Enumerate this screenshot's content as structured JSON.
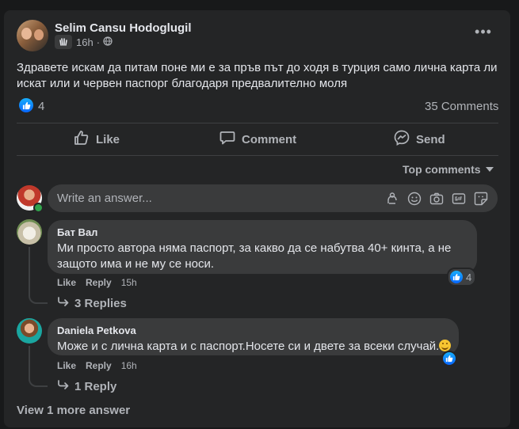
{
  "post": {
    "author": "Selim Cansu Hodoglugil",
    "time": "16h",
    "text": "Здравете искам да питам поне ми е за пръв път до ходя в турция само лична карта ли искат или и червен паспорг благодаря предвалително моля",
    "reaction_count": "4",
    "comments_count": "35 Comments"
  },
  "actions": {
    "like": "Like",
    "comment": "Comment",
    "send": "Send"
  },
  "sort_label": "Top comments",
  "composer": {
    "placeholder": "Write an answer..."
  },
  "comments": [
    {
      "author": "Бат Вал",
      "text": "Ми просто автора няма паспорт, за какво да се набутва 40+ кинта, а не защото има и не му се носи.",
      "like_label": "Like",
      "reply_label": "Reply",
      "time": "15h",
      "reactions": "4",
      "replies": "3 Replies"
    },
    {
      "author": "Daniela Petkova",
      "text": "Може и с лична карта и с паспорт.Носете си и двете за всеки случай.",
      "like_label": "Like",
      "reply_label": "Reply",
      "time": "16h",
      "replies": "1 Reply"
    }
  ],
  "view_more": "View 1 more answer",
  "colors": {
    "background": "#18191a",
    "card": "#242526",
    "bubble": "#3a3b3c",
    "text_primary": "#e4e6eb",
    "text_secondary": "#b0b3b8",
    "like_blue": "#0866ff",
    "online_green": "#31a24c"
  },
  "icons": [
    "wave-icon",
    "globe-icon",
    "more-icon",
    "like-icon",
    "comment-icon",
    "send-icon",
    "chevron-down-icon",
    "avatar-sticker-icon",
    "emoji-icon",
    "camera-icon",
    "gif-icon",
    "sticker-icon",
    "reply-arrow-icon",
    "smile-emoji-icon"
  ]
}
